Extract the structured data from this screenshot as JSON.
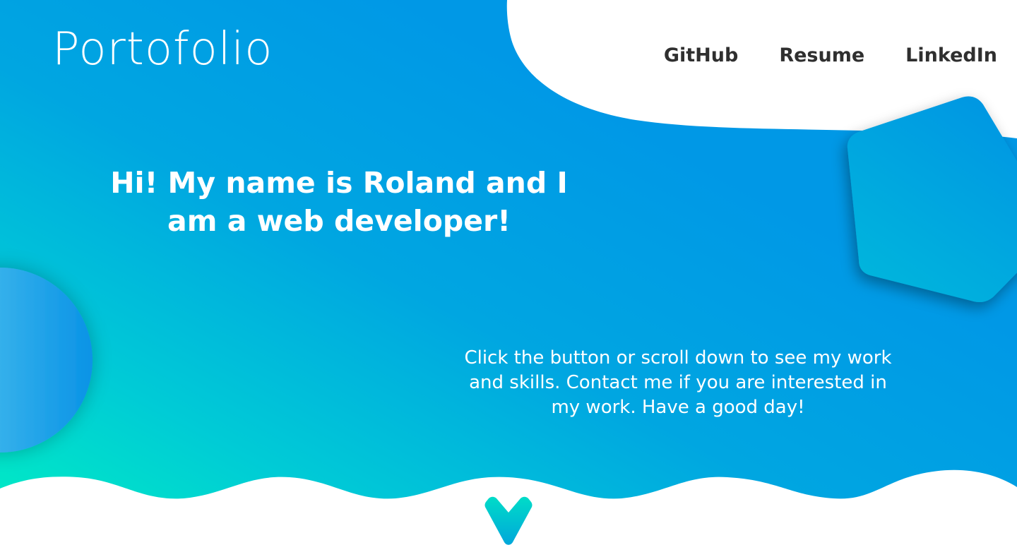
{
  "header": {
    "logo": "Portofolio",
    "nav": [
      {
        "label": "GitHub"
      },
      {
        "label": "Resume"
      },
      {
        "label": "LinkedIn"
      }
    ]
  },
  "hero": {
    "headline": "Hi! My name is Roland and I am a web developer!",
    "intro": "Click the button or scroll down to see my work and skills. Contact me if you are interested in my work. Have a good day!"
  },
  "scroll_button": {
    "icon": "chevron-down-icon"
  },
  "colors": {
    "gradient_teal": "#00e2c8",
    "gradient_blue": "#009be8",
    "nav_text": "#2f2f2f",
    "text_light": "#ffffff"
  }
}
